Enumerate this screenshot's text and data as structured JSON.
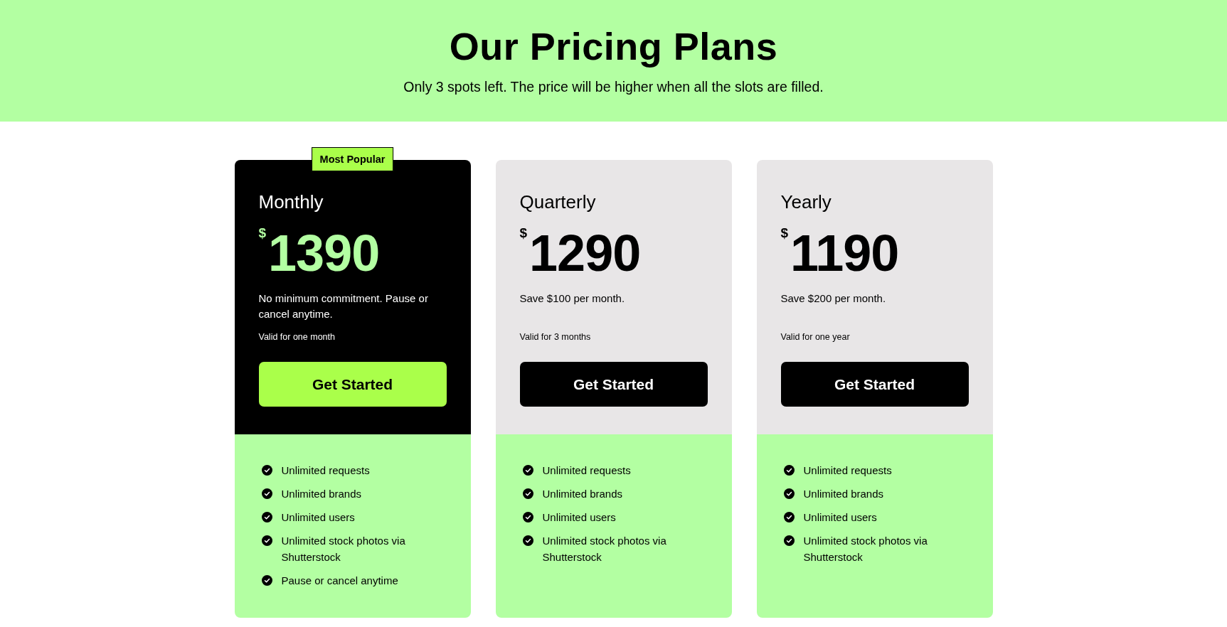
{
  "header": {
    "title": "Our Pricing Plans",
    "subtitle": "Only 3 spots left. The price will be higher when all the slots are filled."
  },
  "plans": [
    {
      "name": "Monthly",
      "featured": true,
      "badge": "Most Popular",
      "currency": "$",
      "price": "1390",
      "description": "No minimum commitment. Pause or cancel anytime.",
      "validity": "Valid for one month",
      "button": "Get Started",
      "features": [
        "Unlimited requests",
        "Unlimited brands",
        "Unlimited users",
        "Unlimited stock photos via Shutterstock",
        "Pause or cancel anytime"
      ]
    },
    {
      "name": "Quarterly",
      "featured": false,
      "currency": "$",
      "price": "1290",
      "description": "Save $100 per month.",
      "validity": "Valid for 3 months",
      "button": "Get Started",
      "features": [
        "Unlimited requests",
        "Unlimited brands",
        "Unlimited users",
        "Unlimited stock photos via Shutterstock"
      ]
    },
    {
      "name": "Yearly",
      "featured": false,
      "currency": "$",
      "price": "1190",
      "description": "Save $200 per month.",
      "validity": "Valid for one year",
      "button": "Get Started",
      "features": [
        "Unlimited requests",
        "Unlimited brands",
        "Unlimited users",
        "Unlimited stock photos via Shutterstock"
      ]
    }
  ]
}
